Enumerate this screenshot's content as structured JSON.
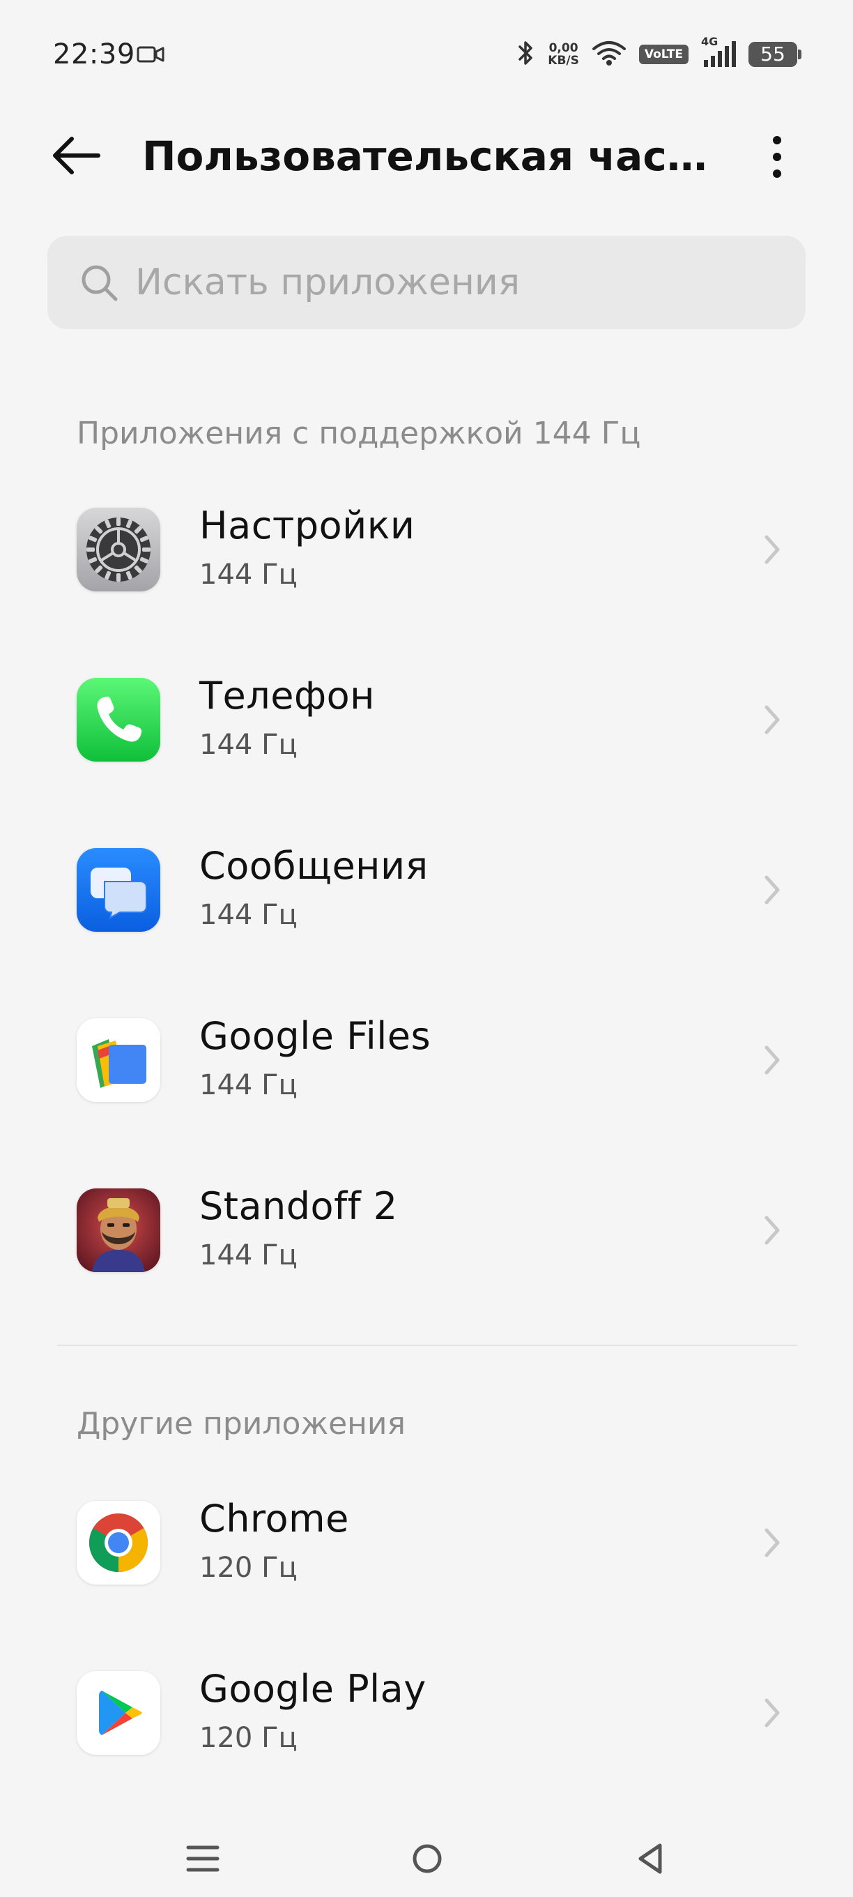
{
  "status_bar": {
    "time": "22:39",
    "net_speed_value": "0,00",
    "net_speed_unit": "KB/S",
    "volte": "VoLTE",
    "network": "4G",
    "battery": "55",
    "icons": [
      "video-camera-icon",
      "bluetooth-icon",
      "wifi-icon",
      "signal-icon"
    ]
  },
  "header": {
    "title": "Пользовательская часто...",
    "back_icon": "arrow-left-icon",
    "more_icon": "more-vertical-icon"
  },
  "search": {
    "placeholder": "Искать приложения",
    "value": ""
  },
  "sections": [
    {
      "title": "Приложения с поддержкой 144 Гц",
      "apps": [
        {
          "name": "Настройки",
          "rate": "144 Гц",
          "icon": "settings-gear-icon"
        },
        {
          "name": "Телефон",
          "rate": "144 Гц",
          "icon": "phone-icon"
        },
        {
          "name": "Сообщения",
          "rate": "144 Гц",
          "icon": "messages-icon"
        },
        {
          "name": "Google Files",
          "rate": "144 Гц",
          "icon": "google-files-icon"
        },
        {
          "name": "Standoff 2",
          "rate": "144 Гц",
          "icon": "standoff-2-icon"
        }
      ]
    },
    {
      "title": "Другие приложения",
      "apps": [
        {
          "name": "Chrome",
          "rate": "120 Гц",
          "icon": "chrome-icon"
        },
        {
          "name": "Google Play",
          "rate": "120 Гц",
          "icon": "google-play-icon"
        }
      ]
    }
  ],
  "nav_bar": {
    "icons": [
      "menu-icon",
      "home-icon",
      "back-triangle-icon"
    ]
  },
  "colors": {
    "background": "#f5f5f5",
    "search_bg": "#e9e9e9",
    "section_header": "#8c8c8c",
    "secondary_text": "#555555"
  }
}
